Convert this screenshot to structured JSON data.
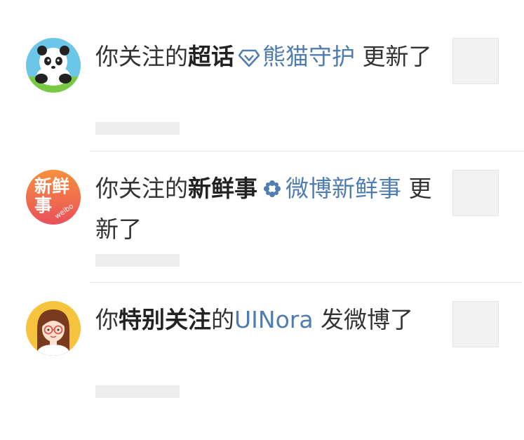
{
  "notifications": [
    {
      "avatar_icon": "panda-avatar-icon",
      "prefix": "你关注的",
      "bold": "超话",
      "link_icon": "diamond-icon",
      "link": "熊猫守护",
      "suffix": " 更新了"
    },
    {
      "avatar_icon": "xinxianshi-weibo-logo-icon",
      "avatar_text_main": "新鲜事",
      "avatar_text_sub": "weibo",
      "prefix": "你关注的",
      "bold": "新鲜事",
      "link_icon": "flower-icon",
      "link": "微博新鲜事",
      "suffix": " 更新了"
    },
    {
      "avatar_icon": "girl-with-glasses-avatar-icon",
      "prefix": "你",
      "bold": "特别关注",
      "mid": "的",
      "link": "UINora",
      "suffix": " 发微博了"
    }
  ],
  "colors": {
    "link": "#507daf",
    "text": "#333333",
    "placeholder": "#ededed",
    "divider": "#e6e6e6"
  }
}
